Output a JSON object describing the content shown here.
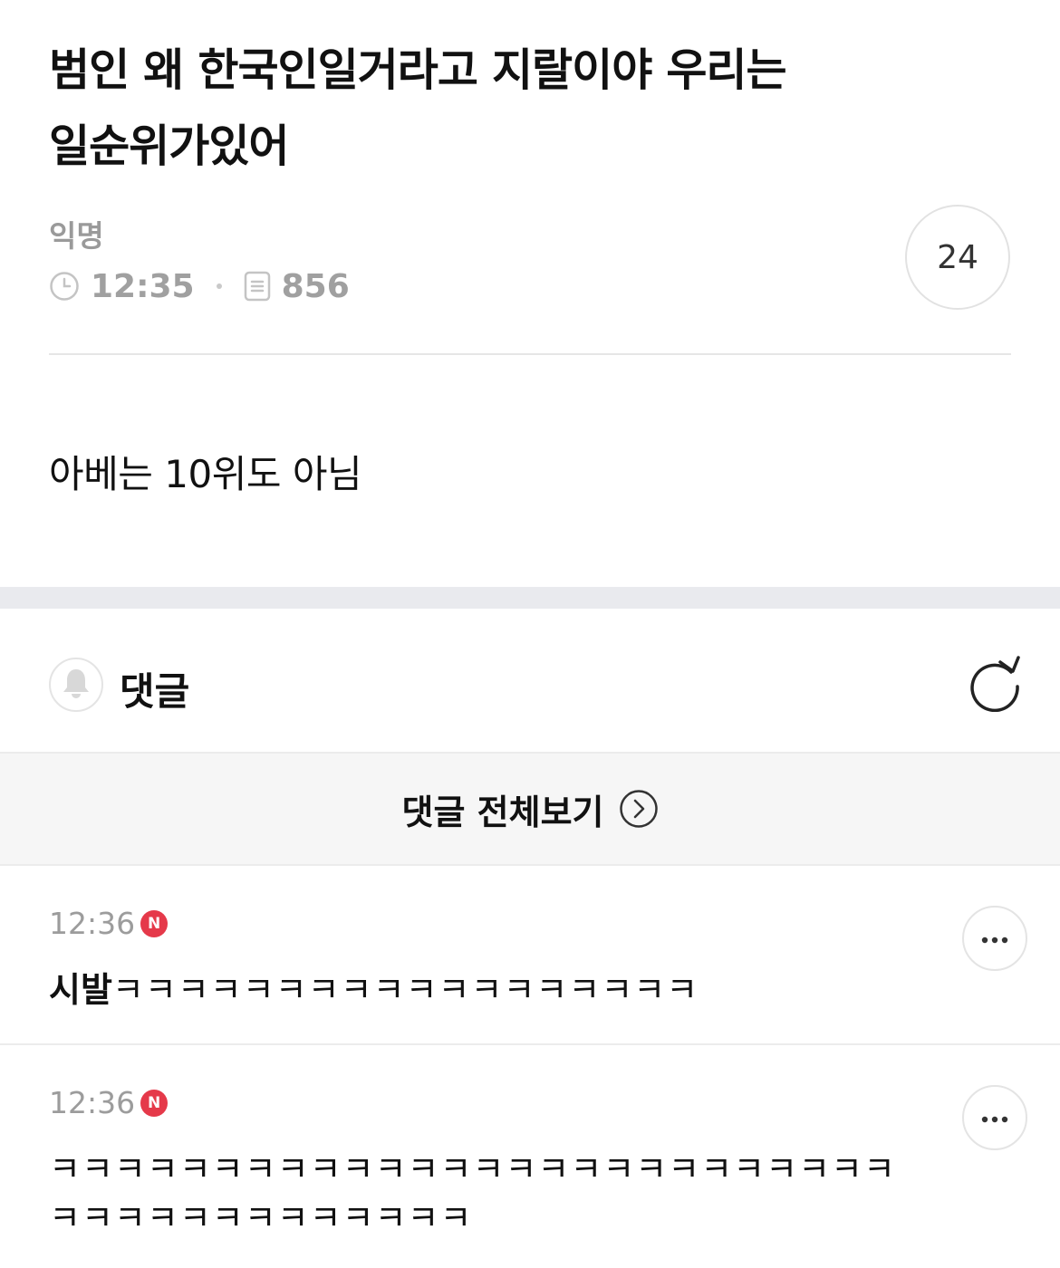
{
  "post": {
    "title": "범인 왜 한국인일거라고 지랄이야 우리는 일순위가있어",
    "author": "익명",
    "time": "12:35",
    "views": "856",
    "comment_count": "24",
    "body": "아베는 10위도 아님"
  },
  "comments_section": {
    "label": "댓글",
    "view_all_label": "댓글 전체보기",
    "icons": {
      "bell": "bell-icon",
      "refresh": "refresh-icon",
      "view_all_arrow": "chevron-right-circle-icon",
      "more": "more-dots-icon"
    }
  },
  "comments": [
    {
      "time": "12:36",
      "badge": "N",
      "text_lead": "시발",
      "text_rest": "ㅋㅋㅋㅋㅋㅋㅋㅋㅋㅋㅋㅋㅋㅋㅋㅋㅋㅋ"
    },
    {
      "time": "12:36",
      "badge": "N",
      "text_lead": "",
      "text_rest": "ㅋㅋㅋㅋㅋㅋㅋㅋㅋㅋㅋㅋㅋㅋㅋㅋㅋㅋㅋㅋㅋㅋㅋㅋㅋㅋㅋㅋㅋㅋㅋㅋㅋㅋㅋㅋㅋㅋㅋ"
    }
  ],
  "colors": {
    "new_badge": "#e5394a",
    "meta_gray": "#9a9a9a",
    "section_gap": "#e9eaee",
    "view_all_bg": "#f6f6f6"
  }
}
